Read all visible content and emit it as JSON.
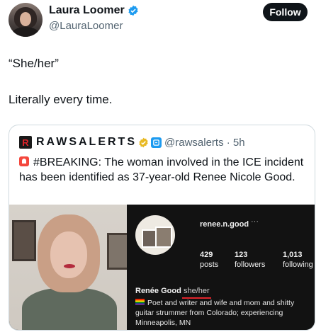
{
  "author": {
    "display_name": "Laura Loomer",
    "handle": "@LauraLoomer",
    "follow_label": "Follow"
  },
  "tweet": {
    "line1": "“She/her”",
    "line2": "Literally every time."
  },
  "quote": {
    "logo_letter": "R",
    "name": "RAWSALERTS",
    "handle_time": "@rawsalerts · 5h",
    "text": "#BREAKING: The woman involved in the ICE incident has been identified as 37-year-old Renee Nicole Good."
  },
  "profile": {
    "username": "renee.n.good",
    "more": "···",
    "stats": [
      {
        "value": "429",
        "label": "posts"
      },
      {
        "value": "123",
        "label": "followers"
      },
      {
        "value": "1,013",
        "label": "following"
      }
    ],
    "name": "Renée Good",
    "pronouns": "she/her",
    "bio": "Poet and writer and wife and mom and shitty guitar strummer from Colorado; experiencing Minneapolis, MN"
  },
  "colors": {
    "verified_blue": "#1d9bf0",
    "gold_badge": "#e8b923",
    "underline_red": "#e0242b"
  },
  "icons": [
    "verified-badge-icon",
    "gold-verified-icon",
    "affiliate-badge-icon",
    "siren-icon",
    "pride-flag-icon"
  ]
}
